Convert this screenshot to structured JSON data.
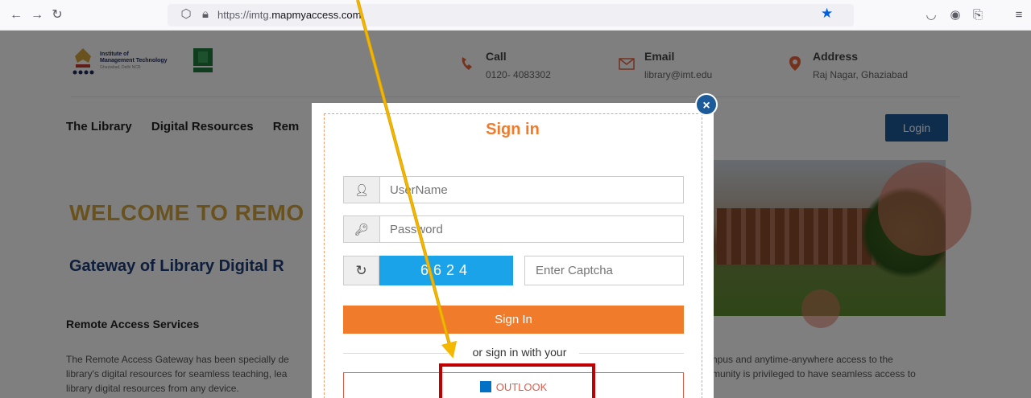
{
  "browser": {
    "url_prefix": "https://imtg.",
    "url_domain": "mapmyaccess.com",
    "back_icon": "back-arrow-icon",
    "forward_icon": "forward-arrow-icon",
    "reload_icon": "reload-icon",
    "bookmark_icon": "star-icon",
    "accent_color": "#0060df"
  },
  "header": {
    "logo_line1": "Institute of",
    "logo_line2": "Management Technology",
    "logo_line3": "Ghaziabad, Delhi NCR",
    "call_title": "Call",
    "call_value": "0120- 4083302",
    "email_title": "Email",
    "email_value": "library@imt.edu",
    "address_title": "Address",
    "address_value": "Raj Nagar, Ghaziabad"
  },
  "nav": {
    "items": [
      "The Library",
      "Digital Resources",
      "Rem"
    ],
    "login_label": "Login"
  },
  "hero": {
    "welcome": "WELCOME TO REMO",
    "gateway": "Gateway of Library Digital R",
    "section_title": "Remote Access Services",
    "para_left": [
      "The Remote Access Gateway has been specially de",
      "library's digital resources for seamless teaching, lea",
      "library digital resources from any device."
    ],
    "para_right": [
      "ampus and anytime-anywhere access to the",
      "mmunity is privileged to have seamless access to"
    ]
  },
  "modal": {
    "title": "Sign in",
    "close_label": "×",
    "username_placeholder": "UserName",
    "password_placeholder": "Password",
    "captcha_code": "6624",
    "captcha_placeholder": "Enter Captcha",
    "signin_label": "Sign In",
    "or_text": "or sign in with your",
    "outlook_label": "OUTLOOK",
    "brand_color": "#f07b2b",
    "primary_color": "#1d5a9a"
  },
  "annotation": {
    "arrow_color": "#f5b800",
    "highlight_color": "#c00000"
  }
}
